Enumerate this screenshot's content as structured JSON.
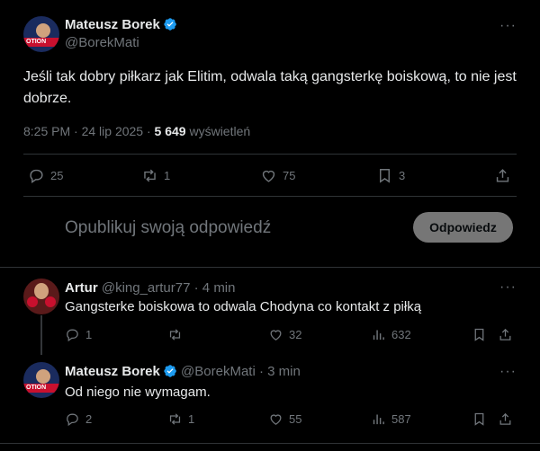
{
  "main": {
    "author_name": "Mateusz Borek",
    "author_handle": "@BorekMati",
    "avatar_label": "OTION",
    "text": "Jeśli tak dobry piłkarz jak Elitim, odwala taką gangsterkę boiskową, to nie jest dobrze.",
    "time": "8:25 PM · 24 lip 2025 · ",
    "views_count": "5 649",
    "views_label": " wyświetleń",
    "replies": "25",
    "reposts": "1",
    "likes": "75",
    "bookmarks": "3",
    "more": "···"
  },
  "compose": {
    "placeholder": "Opublikuj swoją odpowiedź",
    "button": "Odpowiedz"
  },
  "replies": [
    {
      "name": "Artur",
      "handle": "@king_artur77",
      "time": "· 4 min",
      "text": "Gangsterke boiskowa to odwala Chodyna co kontakt z piłką",
      "replies": "1",
      "reposts": "",
      "likes": "32",
      "views": "632"
    },
    {
      "name": "Mateusz Borek",
      "handle": "@BorekMati",
      "time": "· 3 min",
      "avatar_label": "OTION",
      "text": "Od niego nie wymagam.",
      "replies": "2",
      "reposts": "1",
      "likes": "55",
      "views": "587"
    }
  ],
  "colors": {
    "background": "#000000",
    "text": "#e7e9ea",
    "muted": "#71767b",
    "verified": "#1d9bf0",
    "divider": "#2f3336"
  }
}
